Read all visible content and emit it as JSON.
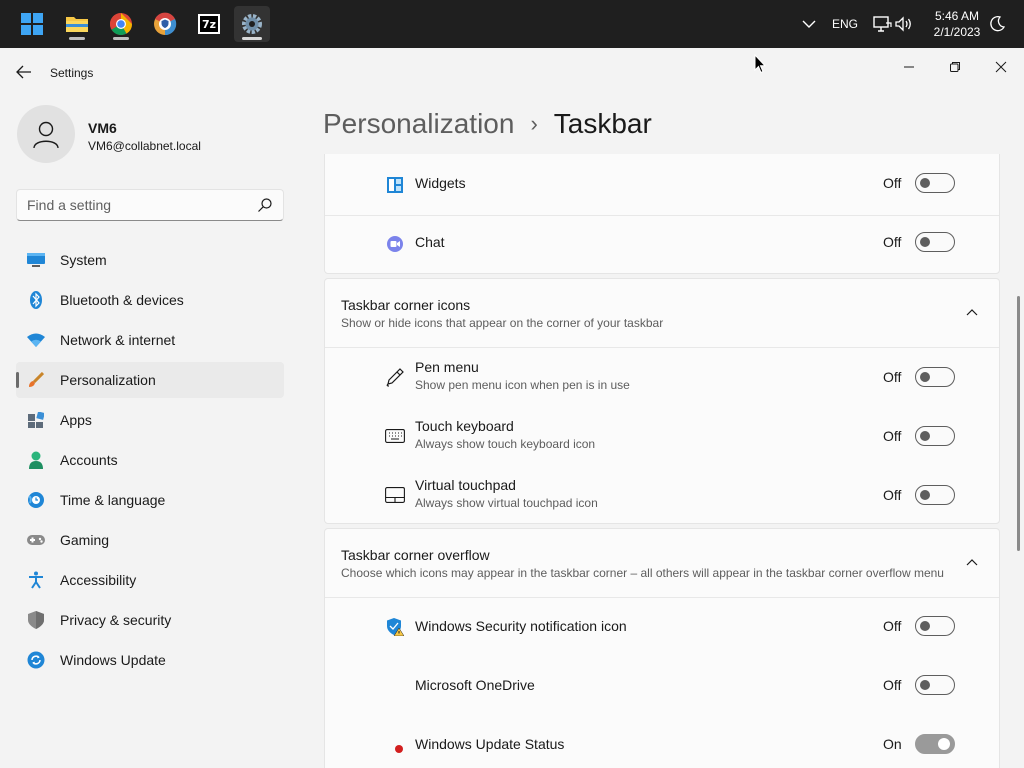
{
  "taskbar": {
    "apps": [
      {
        "name": "start-button",
        "label": "Start"
      },
      {
        "name": "file-explorer",
        "label": "File Explorer"
      },
      {
        "name": "chrome",
        "label": "Google Chrome"
      },
      {
        "name": "shield-browser",
        "label": "Browser"
      },
      {
        "name": "7zip",
        "label": "7-Zip",
        "icon_text": "7z"
      },
      {
        "name": "settings",
        "label": "Settings"
      }
    ],
    "language": "ENG",
    "time": "5:46 AM",
    "date": "2/1/2023"
  },
  "window": {
    "title": "Settings"
  },
  "profile": {
    "name": "VM6",
    "email": "VM6@collabnet.local"
  },
  "search": {
    "placeholder": "Find a setting"
  },
  "nav": [
    {
      "label": "System",
      "icon": "monitor-icon"
    },
    {
      "label": "Bluetooth & devices",
      "icon": "bluetooth-icon"
    },
    {
      "label": "Network & internet",
      "icon": "wifi-icon"
    },
    {
      "label": "Personalization",
      "icon": "brush-icon",
      "selected": true
    },
    {
      "label": "Apps",
      "icon": "apps-icon"
    },
    {
      "label": "Accounts",
      "icon": "person-icon"
    },
    {
      "label": "Time & language",
      "icon": "globe-clock-icon"
    },
    {
      "label": "Gaming",
      "icon": "gamepad-icon"
    },
    {
      "label": "Accessibility",
      "icon": "accessibility-icon"
    },
    {
      "label": "Privacy & security",
      "icon": "shield-icon"
    },
    {
      "label": "Windows Update",
      "icon": "update-icon"
    }
  ],
  "breadcrumb": {
    "parent": "Personalization",
    "separator": "›",
    "current": "Taskbar"
  },
  "taskbar_items": [
    {
      "title": "Widgets",
      "state": "Off",
      "on": false,
      "icon": "widgets-icon"
    },
    {
      "title": "Chat",
      "state": "Off",
      "on": false,
      "icon": "chat-icon"
    }
  ],
  "corner_icons": {
    "title": "Taskbar corner icons",
    "subtitle": "Show or hide icons that appear on the corner of your taskbar",
    "items": [
      {
        "title": "Pen menu",
        "subtitle": "Show pen menu icon when pen is in use",
        "state": "Off",
        "on": false,
        "icon": "pen-icon"
      },
      {
        "title": "Touch keyboard",
        "subtitle": "Always show touch keyboard icon",
        "state": "Off",
        "on": false,
        "icon": "keyboard-icon"
      },
      {
        "title": "Virtual touchpad",
        "subtitle": "Always show virtual touchpad icon",
        "state": "Off",
        "on": false,
        "icon": "touchpad-icon"
      }
    ]
  },
  "corner_overflow": {
    "title": "Taskbar corner overflow",
    "subtitle": "Choose which icons may appear in the taskbar corner – all others will appear in the taskbar corner overflow menu",
    "items": [
      {
        "title": "Windows Security notification icon",
        "state": "Off",
        "on": false,
        "icon": "security-warning-icon"
      },
      {
        "title": "Microsoft OneDrive",
        "state": "Off",
        "on": false,
        "icon": "onedrive-icon"
      },
      {
        "title": "Windows Update Status",
        "state": "On",
        "on": true,
        "icon": "update-status-icon"
      }
    ]
  },
  "colors": {
    "taskbar_bg": "#1f1f1f",
    "window_bg": "#f3f3f3",
    "card_bg": "#fbfbfb",
    "accent": "#0067c0"
  }
}
